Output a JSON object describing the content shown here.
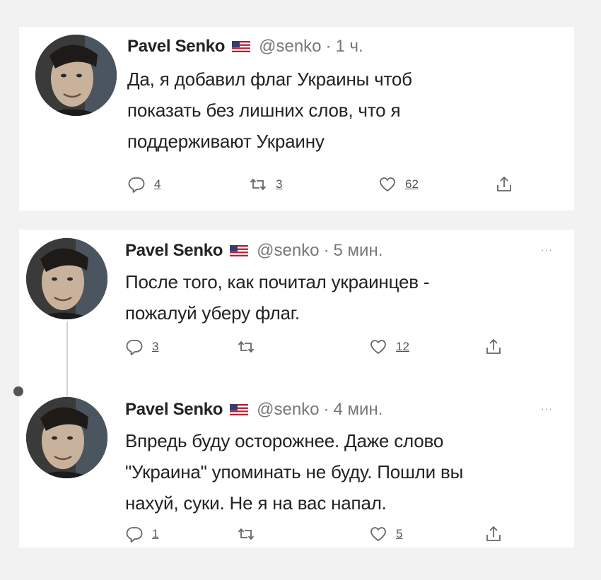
{
  "tweets": [
    {
      "name": "Pavel Senko",
      "handle": "@senko",
      "dot": "·",
      "time": "1 ч.",
      "lines": [
        "Да, я добавил флаг Украины чтоб",
        "показать без лишних слов, что я",
        "поддерживают Украину"
      ],
      "reply_count": "4",
      "retweet_count": "3",
      "like_count": "62"
    },
    {
      "name": "Pavel Senko",
      "handle": "@senko",
      "dot": "·",
      "time": "5 мин.",
      "more": "···",
      "lines": [
        "После того, как почитал украинцев -",
        "пожалуй уберу флаг."
      ],
      "reply_count": "3",
      "retweet_count": "",
      "like_count": "12"
    },
    {
      "name": "Pavel Senko",
      "handle": "@senko",
      "dot": "·",
      "time": "4 мин.",
      "more": "···",
      "lines": [
        "Впредь буду осторожнее. Даже слово",
        "\"Украина\" упоминать не буду. Пошли вы",
        "нахуй, суки. Не я на вас напал."
      ],
      "reply_count": "1",
      "retweet_count": "",
      "like_count": "5"
    }
  ],
  "icons": {
    "reply": "reply-icon",
    "retweet": "retweet-icon",
    "like": "heart-icon",
    "share": "share-icon",
    "flag": "us-flag-icon"
  },
  "colors": {
    "background": "#f2f2f2",
    "card": "#ffffff",
    "text": "#222222",
    "muted": "#777777"
  }
}
